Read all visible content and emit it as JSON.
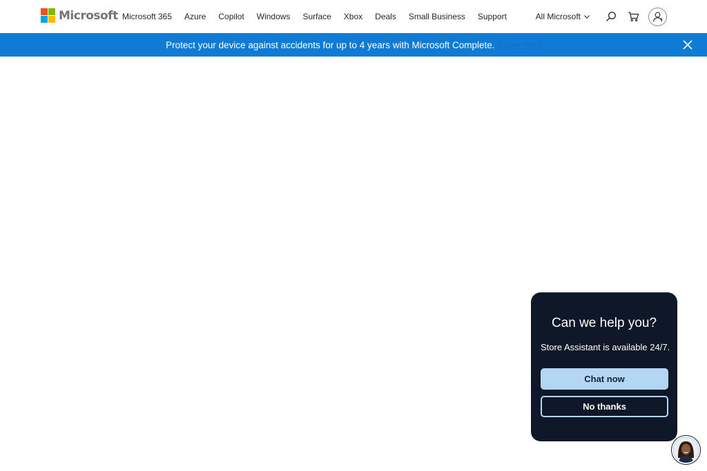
{
  "header": {
    "brand": "Microsoft",
    "logo_colors": [
      "#f25022",
      "#7fba00",
      "#00a4ef",
      "#ffb900"
    ],
    "nav": [
      {
        "label": "Microsoft 365"
      },
      {
        "label": "Azure"
      },
      {
        "label": "Copilot"
      },
      {
        "label": "Windows"
      },
      {
        "label": "Surface"
      },
      {
        "label": "Xbox"
      },
      {
        "label": "Deals"
      },
      {
        "label": "Small Business"
      },
      {
        "label": "Support"
      }
    ],
    "all_microsoft": "All Microsoft",
    "icons": {
      "search": "search-icon",
      "cart": "cart-icon",
      "account": "account-icon"
    }
  },
  "banner": {
    "text": "Protect your device against accidents for up to 4 years with Microsoft Complete.",
    "link": "Learn more",
    "background": "#0f7bd4"
  },
  "chat": {
    "title": "Can we help you?",
    "subtitle": "Store Assistant is available 24/7.",
    "chat_now": "Chat now",
    "no_thanks": "No thanks",
    "card_color": "#0f1828",
    "accent": "#b3d7f3"
  }
}
